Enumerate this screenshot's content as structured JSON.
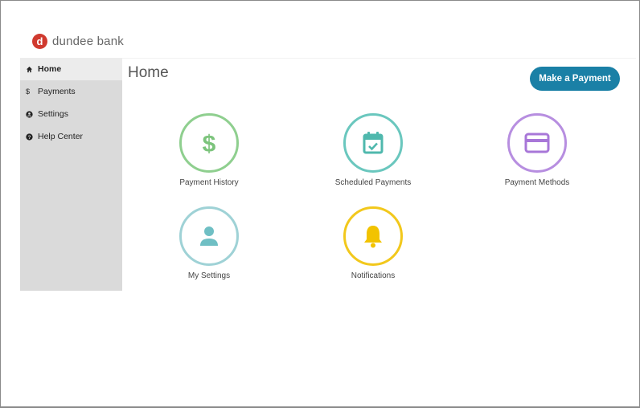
{
  "brand": {
    "name": "dundee bank",
    "mark": "d"
  },
  "sidebar": {
    "items": [
      {
        "label": "Home",
        "icon": "home-icon",
        "glyph": "🏠︎"
      },
      {
        "label": "Payments",
        "icon": "dollar-icon",
        "glyph": "$"
      },
      {
        "label": "Settings",
        "icon": "user-circle-icon",
        "glyph": "●"
      },
      {
        "label": "Help Center",
        "icon": "question-circle-icon",
        "glyph": "●"
      }
    ]
  },
  "main": {
    "title": "Home",
    "cta_label": "Make a Payment",
    "tiles": [
      {
        "label": "Payment History",
        "icon": "dollar-icon",
        "color": "#8fcf8f"
      },
      {
        "label": "Scheduled Payments",
        "icon": "calendar-check-icon",
        "color": "#6ac7be"
      },
      {
        "label": "Payment Methods",
        "icon": "credit-card-icon",
        "color": "#b78ee0"
      },
      {
        "label": "My Settings",
        "icon": "user-icon",
        "color": "#9fd2d6"
      },
      {
        "label": "Notifications",
        "icon": "bell-icon",
        "color": "#f2c81c"
      }
    ]
  },
  "colors": {
    "accent": "#1a80a6",
    "logo": "#d03a2f",
    "sidebar": "#dadada"
  }
}
